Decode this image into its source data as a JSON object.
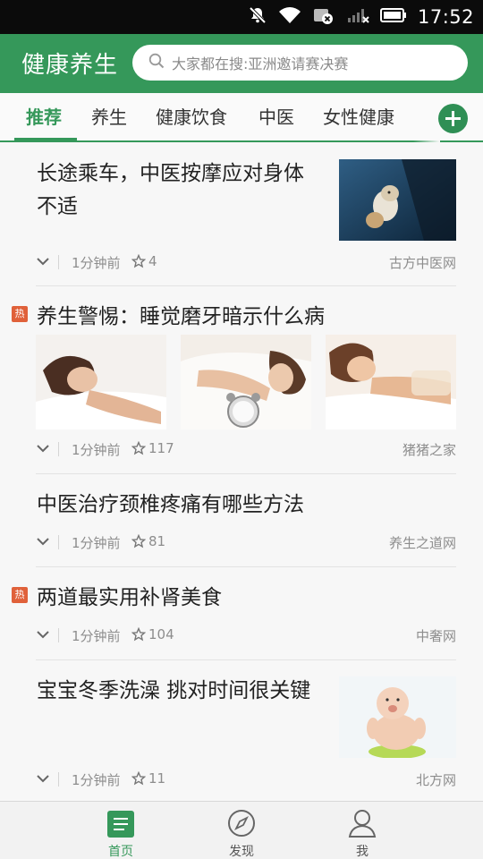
{
  "status_bar": {
    "time": "17:52",
    "icons": [
      "mute-icon",
      "wifi-icon",
      "sim-icon",
      "signal-icon",
      "battery-icon"
    ]
  },
  "header": {
    "title": "健康养生",
    "search_placeholder": "大家都在搜:亚洲邀请赛决赛"
  },
  "tabs": [
    {
      "label": "推荐",
      "active": true
    },
    {
      "label": "养生",
      "active": false
    },
    {
      "label": "健康饮食",
      "active": false
    },
    {
      "label": "中医",
      "active": false
    },
    {
      "label": "女性健康",
      "active": false
    }
  ],
  "colors": {
    "accent": "#35985a",
    "hot": "#e0613a",
    "status_bar": "#0b0b0b"
  },
  "feed": [
    {
      "title": "长途乘车，中医按摩应对身体不适",
      "hot": false,
      "time": "1分钟前",
      "stars": "4",
      "source": "古方中医网",
      "image": "dog-in-car-window"
    },
    {
      "title": "养生警惕：睡觉磨牙暗示什么病",
      "hot": true,
      "hot_label": "热",
      "time": "1分钟前",
      "stars": "117",
      "source": "猪猪之家",
      "images": [
        "sleeping-woman-1",
        "sleeping-woman-alarm-clock",
        "sleeping-woman-2"
      ]
    },
    {
      "title": "中医治疗颈椎疼痛有哪些方法",
      "hot": false,
      "time": "1分钟前",
      "stars": "81",
      "source": "养生之道网"
    },
    {
      "title": "两道最实用补肾美食",
      "hot": true,
      "hot_label": "热",
      "time": "1分钟前",
      "stars": "104",
      "source": "中奢网"
    },
    {
      "title": "宝宝冬季洗澡 挑对时间很关键",
      "hot": false,
      "time": "1分钟前",
      "stars": "11",
      "source": "北方网",
      "image": "baby-on-potty"
    }
  ],
  "bottom_nav": [
    {
      "label": "首页",
      "icon": "home-list-icon",
      "active": true
    },
    {
      "label": "发现",
      "icon": "compass-icon",
      "active": false
    },
    {
      "label": "我",
      "icon": "user-icon",
      "active": false
    }
  ]
}
